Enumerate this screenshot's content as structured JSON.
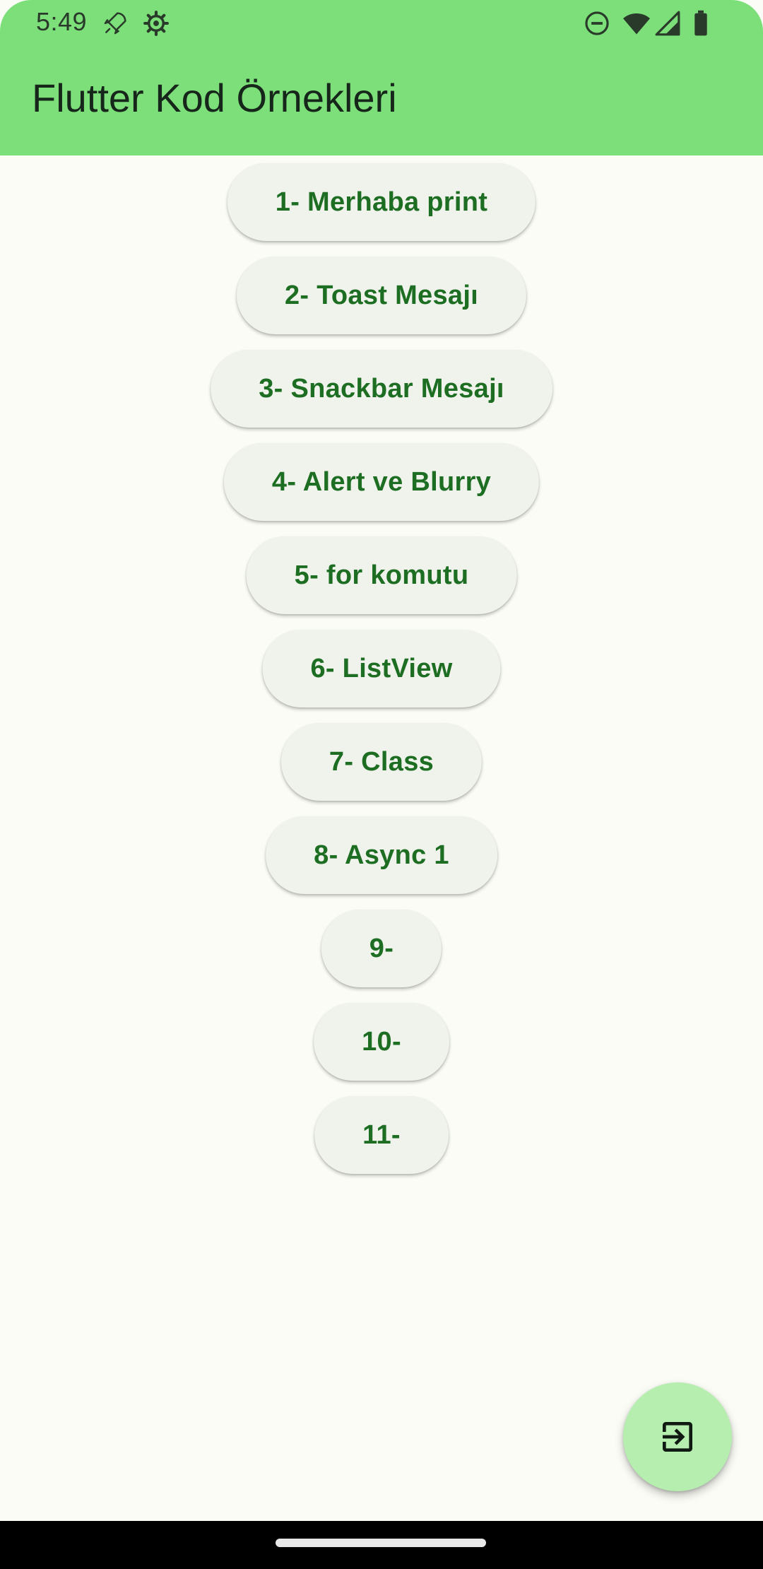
{
  "status_bar": {
    "time": "5:49",
    "left_icons": [
      "rocket-icon",
      "gear-icon"
    ],
    "right_icons": [
      "do-not-disturb-icon",
      "wifi-icon",
      "cell-signal-icon",
      "battery-icon"
    ],
    "background": "#7cdf7a"
  },
  "app_bar": {
    "title": "Flutter Kod Örnekleri",
    "background": "#7cdf7a"
  },
  "buttons": [
    {
      "label": "1- Merhaba print"
    },
    {
      "label": "2- Toast Mesajı"
    },
    {
      "label": "3- Snackbar Mesajı"
    },
    {
      "label": "4- Alert ve Blurry"
    },
    {
      "label": "5- for komutu"
    },
    {
      "label": "6- ListView"
    },
    {
      "label": "7- Class"
    },
    {
      "label": "8- Async 1"
    },
    {
      "label": "9-"
    },
    {
      "label": "10-"
    },
    {
      "label": "11-"
    }
  ],
  "fab": {
    "icon": "exit-icon",
    "background": "#b6eeb0"
  },
  "colors": {
    "button_text": "#1d6e22",
    "button_bg": "#eff3ec",
    "page_bg": "#fbfcf6"
  }
}
